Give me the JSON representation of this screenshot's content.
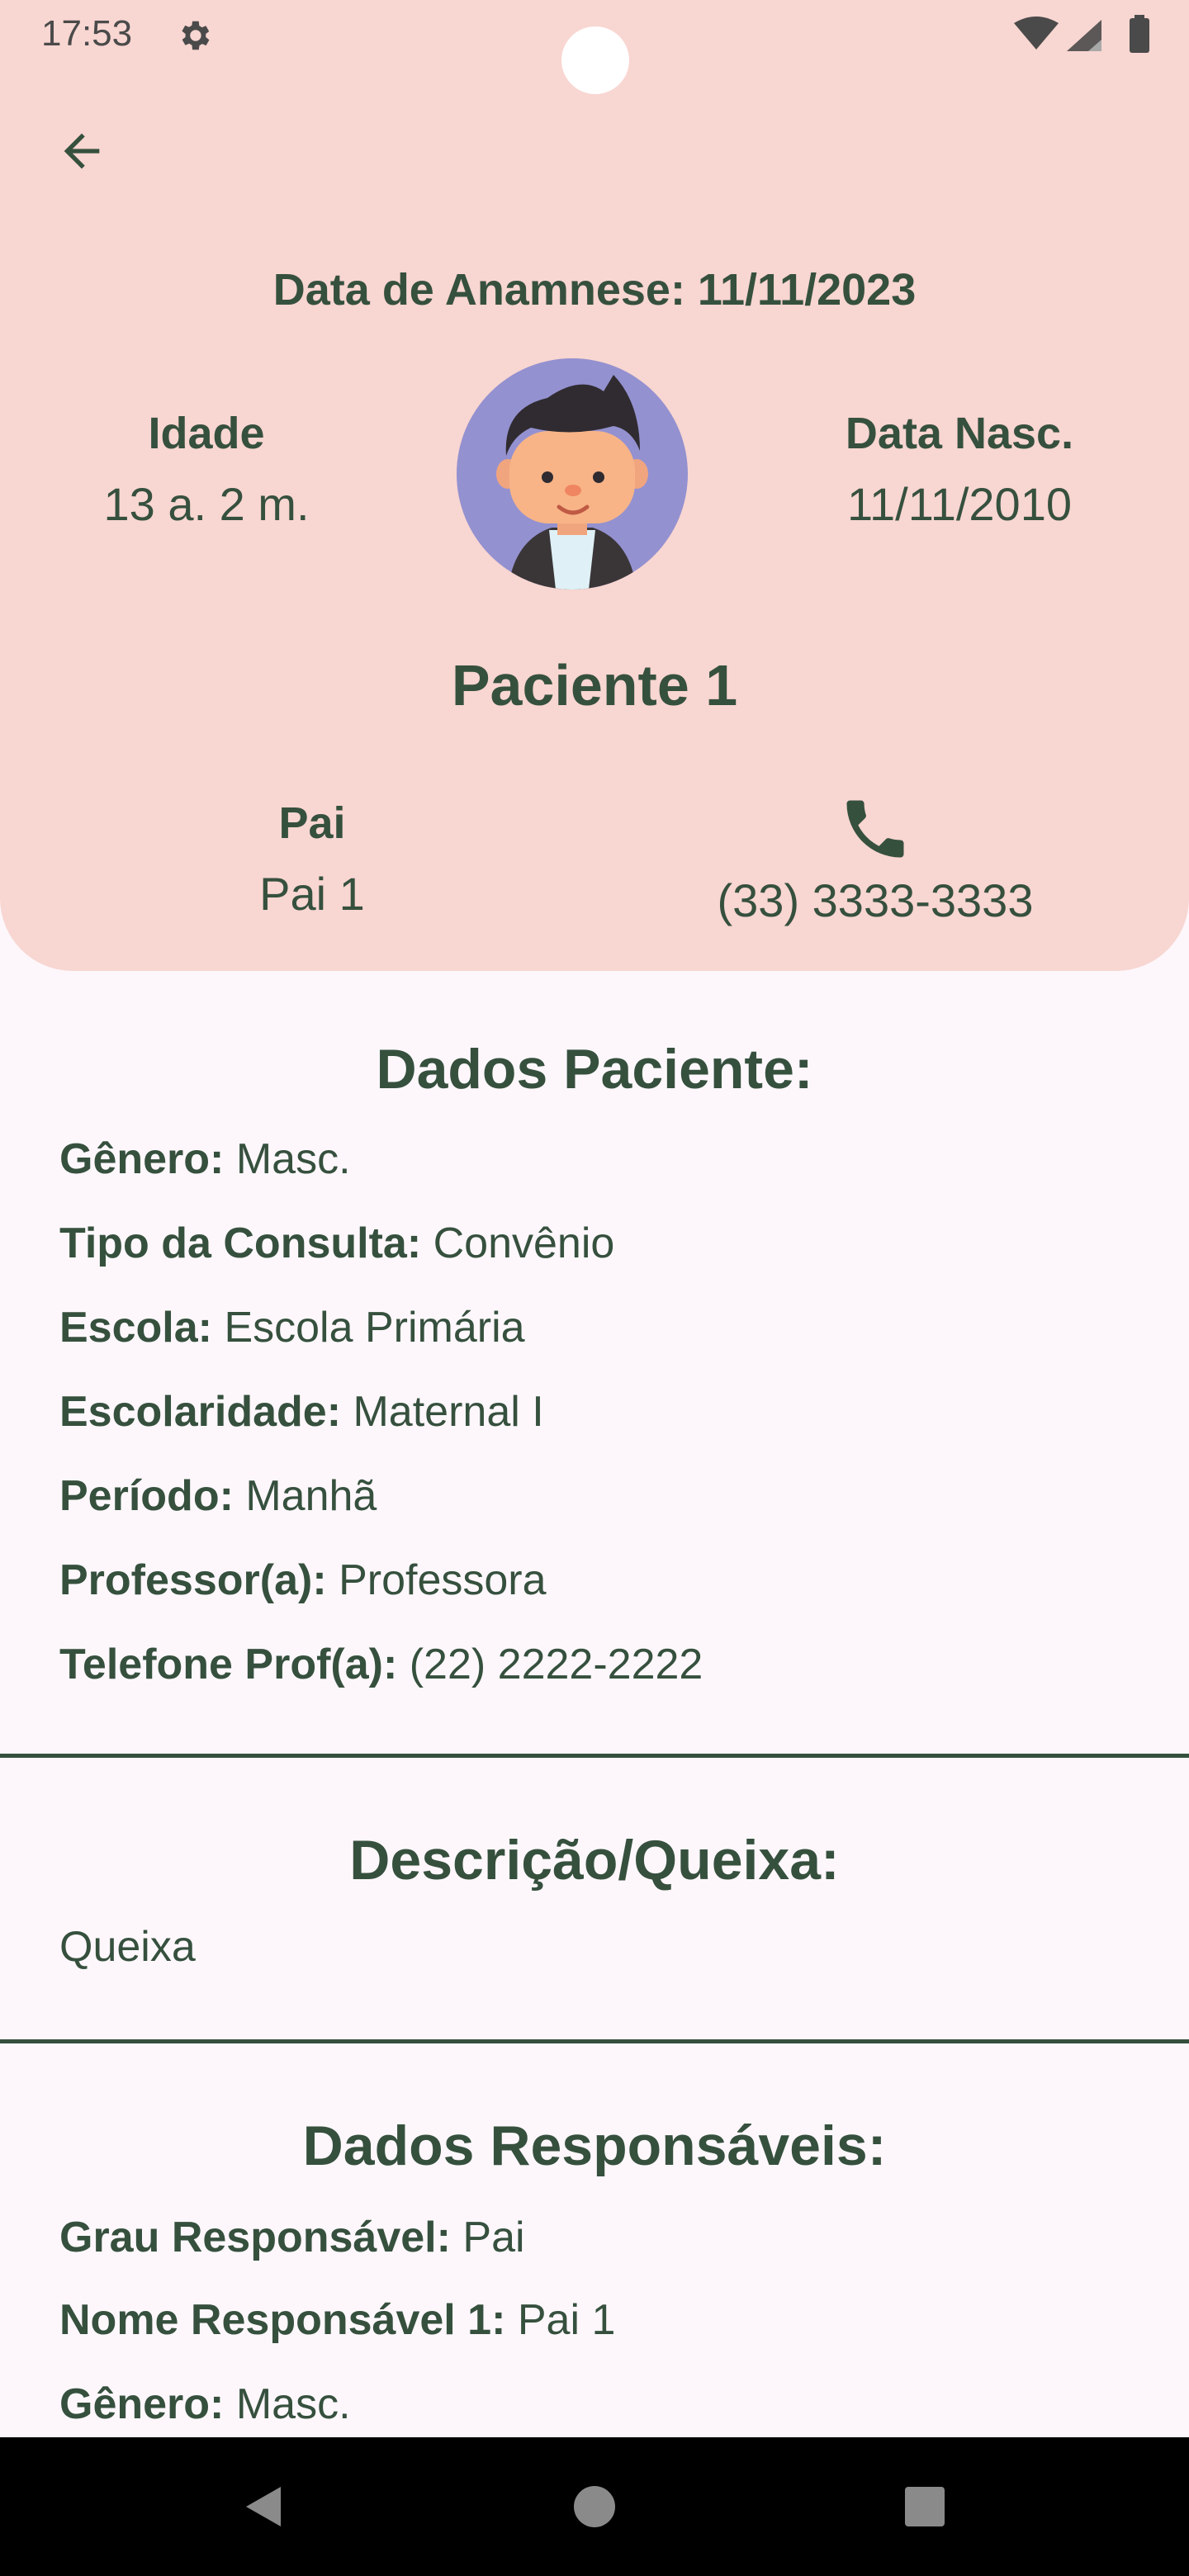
{
  "status_bar": {
    "time": "17:53",
    "icons": [
      "gear-icon",
      "wifi-icon",
      "signal-icon",
      "battery-icon"
    ]
  },
  "header": {
    "back_icon": "arrow-left-icon",
    "anamnese": "Data de Anamnese: 11/11/2023",
    "age_label": "Idade",
    "age_value": "13 a. 2 m.",
    "birth_label": "Data Nasc.",
    "birth_value": "11/11/2010",
    "patient_name": "Paciente 1",
    "parent_label": "Pai",
    "parent_value": "Pai 1",
    "phone_icon": "phone-icon",
    "phone_number": "(33) 3333-3333"
  },
  "patient_section": {
    "title": "Dados Paciente:",
    "fields": [
      {
        "label": "Gênero:",
        "value": "Masc."
      },
      {
        "label": "Tipo da Consulta:",
        "value": "Convênio"
      },
      {
        "label": "Escola:",
        "value": "Escola Primária"
      },
      {
        "label": "Escolaridade:",
        "value": "Maternal I"
      },
      {
        "label": "Período:",
        "value": "Manhã"
      },
      {
        "label": "Professor(a):",
        "value": "Professora"
      },
      {
        "label": "Telefone Prof(a):",
        "value": "(22) 2222-2222"
      }
    ]
  },
  "complaint_section": {
    "title": "Descrição/Queixa:",
    "text": "Queixa"
  },
  "guardians_section": {
    "title": "Dados Responsáveis:",
    "fields": [
      {
        "label": "Grau Responsável:",
        "value": "Pai"
      },
      {
        "label": "Nome Responsável 1:",
        "value": "Pai 1"
      },
      {
        "label": "Gênero:",
        "value": "Masc."
      }
    ]
  },
  "colors": {
    "header_bg": "#f8d6d1",
    "page_bg": "#fdf7fb",
    "text": "#36503e",
    "avatar_bg": "#9491d0"
  }
}
